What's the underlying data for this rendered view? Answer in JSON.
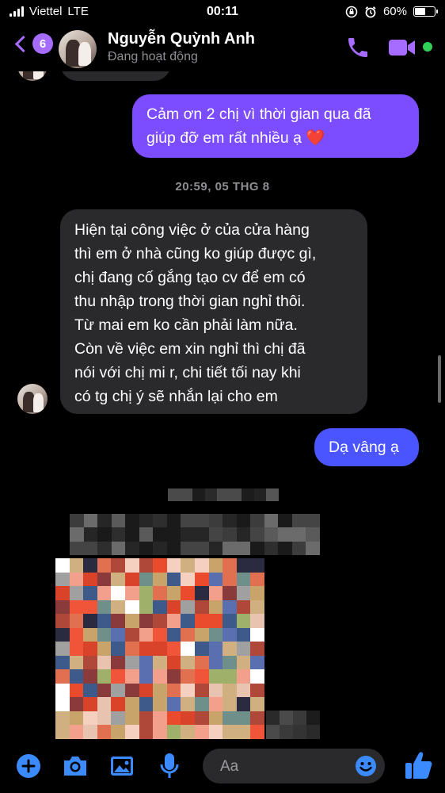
{
  "status_bar": {
    "carrier": "Viettel",
    "network": "LTE",
    "time": "00:11",
    "battery": "60%",
    "battery_level": 0.6
  },
  "header": {
    "unread_count": "6",
    "contact_name": "Nguyễn Quỳnh Anh",
    "presence": "Đang hoạt động",
    "accent_color": "#a66cff",
    "online_color": "#31d158"
  },
  "messages": {
    "sent_1": {
      "lines": [
        "Cảm ơn 2 chị vì thời gian qua đã",
        "giúp đỡ em rất nhiều ạ"
      ],
      "emoji": "❤️"
    },
    "timestamp": "20:59, 05 THG 8",
    "received_1": {
      "lines": [
        "Hiện tại công việc ở của cửa hàng",
        "thì em ở nhà cũng ko giúp được gì,",
        "chị đang cố gắng tạo cv để em có",
        "thu nhập trong thời gian nghỉ thôi.",
        "Từ mai em ko cần phải làm nữa.",
        "Còn về việc em xin nghỉ thì chị đã",
        "nói với chị mi r, chi tiết tối nay khi",
        "có tg chị ý sẽ nhắn lại cho em"
      ]
    },
    "sent_2": {
      "text": "Dạ vâng ạ"
    }
  },
  "input_bar": {
    "placeholder": "Aa",
    "icons": [
      "plus-icon",
      "camera-icon",
      "image-icon",
      "microphone-icon",
      "emoji-icon",
      "thumbs-up-icon"
    ],
    "icon_color": "#3b8bff"
  },
  "colors": {
    "sent_bubble": "#7c4dff",
    "sent_bubble_2": "#4a55ff",
    "received_bubble": "#2a2a2d",
    "background": "#000000"
  }
}
